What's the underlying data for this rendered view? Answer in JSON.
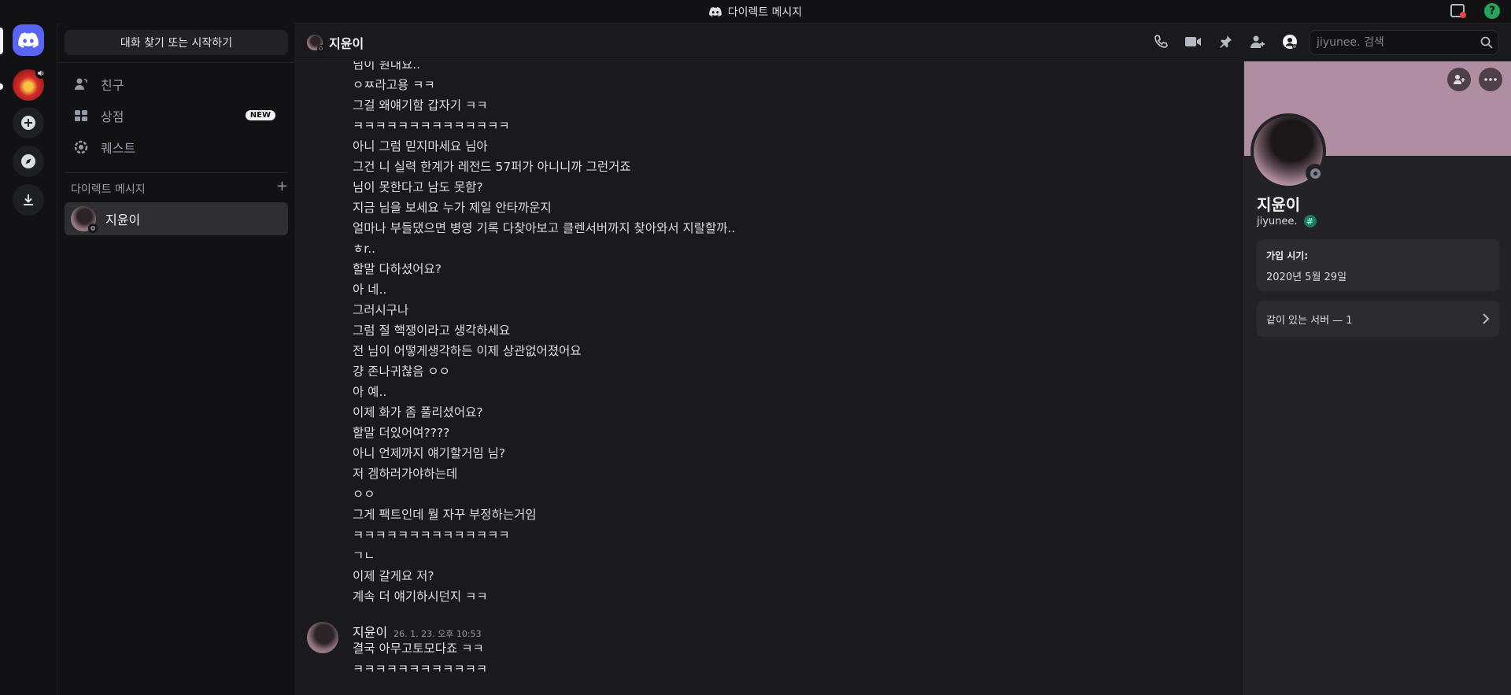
{
  "titlebar": {
    "title": "다이렉트 메시지"
  },
  "sidebar": {
    "find_button": "대화 찾기 또는 시작하기",
    "nav": [
      {
        "label": "친구",
        "icon": "friends-icon"
      },
      {
        "label": "상점",
        "icon": "shop-icon",
        "badge": "NEW"
      },
      {
        "label": "퀘스트",
        "icon": "quest-icon"
      }
    ],
    "dm_header": "다이렉트 메시지",
    "dm_items": [
      {
        "name": "지윤이"
      }
    ]
  },
  "chat_header": {
    "name": "지윤이",
    "search_placeholder": "jiyunee. 검색"
  },
  "messages": [
    "님이 원내요..",
    "ㅇㅉ라고용 ㅋㅋ",
    "그걸 왜얘기함 갑자기 ㅋㅋ",
    "ㅋㅋㅋㅋㅋㅋㅋㅋㅋㅋㅋㅋㅋㅋ",
    "아니 그럼 믿지마세요 님아",
    "그건 니 실력 한계가 레전드 57퍼가 아니니까 그런거죠",
    "님이 못한다고 남도 못함?",
    "지금 님을 보세요 누가 제일 안타까운지",
    "얼마나 부들댔으면 병영 기록 다찾아보고 클렌서버까지 찾아와서 지랄할까..",
    "ㅎr..",
    "할말 다하셨어요?",
    "아 네..",
    "그러시구나",
    "그럼 절 핵쟁이라고 생각하세요",
    "전 님이 어떻게생각하든 이제 상관없어졌어요",
    "걍 존나귀찮음 ㅇㅇ",
    "아 예..",
    "이제 화가 좀 풀리셨어요?",
    "할말 더있어여????",
    "아니 언제까지 얘기할거임 님?",
    "저 겜하러가야하는데",
    "ㅇㅇ",
    "그게 팩트인데 뭘 자꾸 부정하는거임",
    "ㅋㅋㅋㅋㅋㅋㅋㅋㅋㅋㅋㅋㅋㅋ",
    "ㄱㄴ",
    "이제 갈게요 저?",
    "계속 더 얘기하시던지 ㅋㅋ"
  ],
  "last_group": {
    "author": "지윤이",
    "timestamp": "26. 1. 23. 오후 10:53",
    "lines": [
      "결국 아무고토모다죠 ㅋㅋ",
      "ㅋㅋㅋㅋㅋㅋㅋㅋㅋㅋㅋㅋ"
    ]
  },
  "profile": {
    "display_name": "지윤이",
    "username": "jiyunee.",
    "badge": "#",
    "member_since_label": "가입 시기:",
    "member_since_value": "2020년 5월 29일",
    "mutual_servers": "같이 있는 서버 — 1"
  },
  "colors": {
    "accent": "#5865f2",
    "banner": "#ae8ea0",
    "online_help": "#23a55a",
    "notification": "#f23f43"
  }
}
